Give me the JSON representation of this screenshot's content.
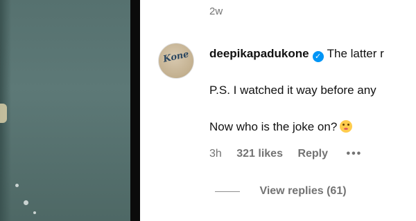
{
  "post": {
    "timestamp": "2w"
  },
  "comment": {
    "username": "deepikapadukone",
    "avatar_text": "Kone",
    "verified": true,
    "line1": "The latter r",
    "line2": "P.S. I watched it way before any",
    "line3": "Now who is the joke on?",
    "emoji": "blushing-face-emoji",
    "time": "3h",
    "likes": "321 likes",
    "reply_label": "Reply",
    "more_label": "•••",
    "view_replies": "View replies (61)"
  },
  "colors": {
    "verified_blue": "#0095f6",
    "muted_text": "#737373",
    "media_bg": "#56716f"
  }
}
